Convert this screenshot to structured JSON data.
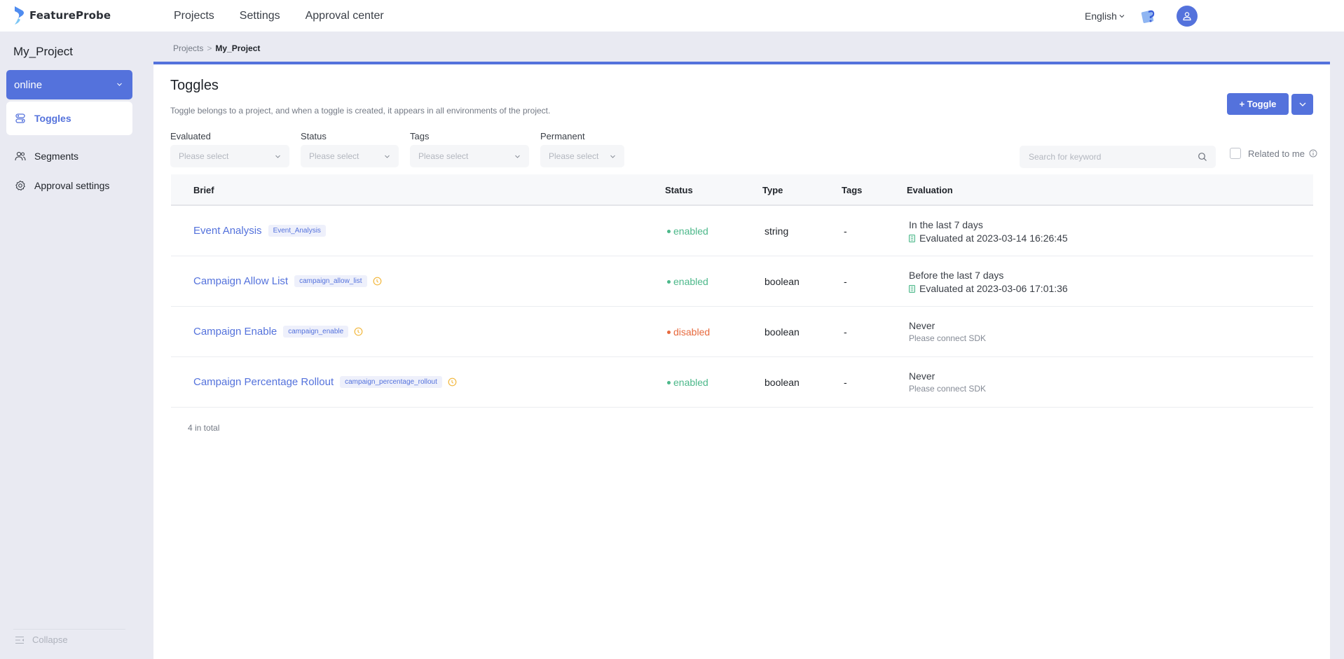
{
  "brand": {
    "name": "FeatureProbe"
  },
  "topnav": {
    "links": [
      "Projects",
      "Settings",
      "Approval center"
    ],
    "language": "English"
  },
  "sidebar": {
    "project_name": "My_Project",
    "environment": "online",
    "items": [
      {
        "label": "Toggles",
        "icon": "toggle-icon",
        "active": true
      },
      {
        "label": "Segments",
        "icon": "users-icon",
        "active": false
      },
      {
        "label": "Approval settings",
        "icon": "gear-icon",
        "active": false
      }
    ],
    "collapse_label": "Collapse"
  },
  "breadcrumb": {
    "parent": "Projects",
    "current": "My_Project"
  },
  "page": {
    "title": "Toggles",
    "description": "Toggle belongs to a project, and when a toggle is created, it appears in all environments of the project.",
    "add_button": "+ Toggle"
  },
  "filters": [
    {
      "label": "Evaluated",
      "placeholder": "Please select"
    },
    {
      "label": "Status",
      "placeholder": "Please select"
    },
    {
      "label": "Tags",
      "placeholder": "Please select"
    },
    {
      "label": "Permanent",
      "placeholder": "Please select"
    }
  ],
  "search": {
    "placeholder": "Search for keyword",
    "value": ""
  },
  "related_to_me": {
    "label": "Related to me",
    "checked": false
  },
  "table": {
    "columns": [
      "Brief",
      "Status",
      "Type",
      "Tags",
      "Evaluation"
    ],
    "rows": [
      {
        "name": "Event Analysis",
        "key": "Event_Analysis",
        "has_clock": false,
        "status": "enabled",
        "type": "string",
        "tags": "-",
        "eval_main": "In the last 7 days",
        "eval_sub": "Evaluated at 2023-03-14 16:26:45",
        "eval_hint": null
      },
      {
        "name": "Campaign Allow List",
        "key": "campaign_allow_list",
        "has_clock": true,
        "status": "enabled",
        "type": "boolean",
        "tags": "-",
        "eval_main": "Before the last 7 days",
        "eval_sub": "Evaluated at 2023-03-06 17:01:36",
        "eval_hint": null
      },
      {
        "name": "Campaign Enable",
        "key": "campaign_enable",
        "has_clock": true,
        "status": "disabled",
        "type": "boolean",
        "tags": "-",
        "eval_main": "Never",
        "eval_sub": null,
        "eval_hint": "Please connect SDK"
      },
      {
        "name": "Campaign Percentage Rollout",
        "key": "campaign_percentage_rollout",
        "has_clock": true,
        "status": "enabled",
        "type": "boolean",
        "tags": "-",
        "eval_main": "Never",
        "eval_sub": null,
        "eval_hint": "Please connect SDK"
      }
    ],
    "total_label": "4 in total"
  },
  "colors": {
    "primary": "#5472dc",
    "enabled": "#4cb88a",
    "disabled": "#e76a3e",
    "clock": "#f2b73d"
  }
}
